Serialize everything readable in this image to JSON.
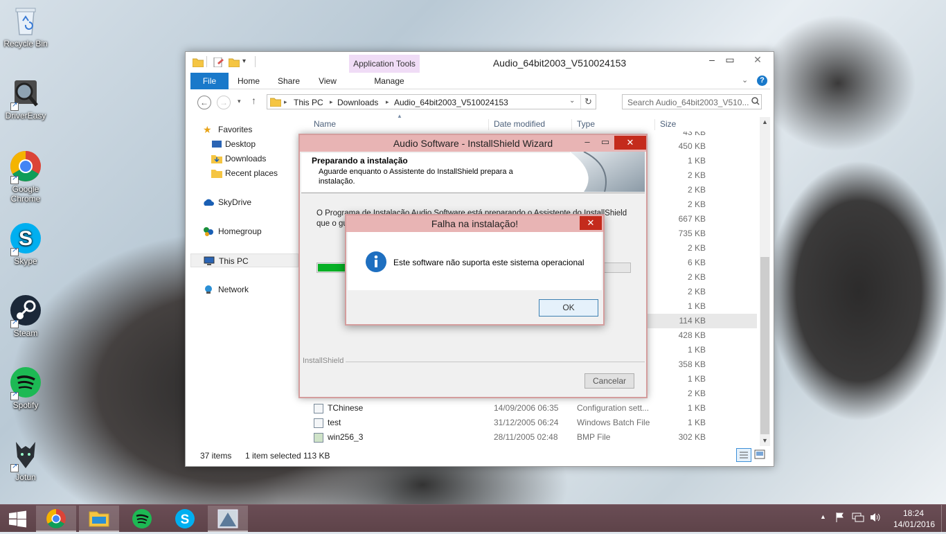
{
  "desktop": {
    "icons": [
      {
        "label": "Recycle Bin",
        "icon": "recycle-bin-icon"
      },
      {
        "label": "DriverEasy",
        "icon": "drivereasy-icon"
      },
      {
        "label": "Google Chrome",
        "icon": "chrome-icon"
      },
      {
        "label": "Skype",
        "icon": "skype-icon"
      },
      {
        "label": "Steam",
        "icon": "steam-icon"
      },
      {
        "label": "Spotify",
        "icon": "spotify-icon"
      },
      {
        "label": "Jotun",
        "icon": "jotun-icon"
      }
    ]
  },
  "explorer": {
    "title": "Audio_64bit2003_V510024153",
    "context_tab": "Application Tools",
    "ribbon_tabs": [
      "File",
      "Home",
      "Share",
      "View",
      "Manage"
    ],
    "breadcrumb": [
      "This PC",
      "Downloads",
      "Audio_64bit2003_V510024153"
    ],
    "search_placeholder": "Search Audio_64bit2003_V510...",
    "nav": {
      "favorites": "Favorites",
      "desktop": "Desktop",
      "downloads": "Downloads",
      "recent": "Recent places",
      "skydrive": "SkyDrive",
      "homegroup": "Homegroup",
      "this_pc": "This PC",
      "network": "Network"
    },
    "columns": {
      "name": "Name",
      "date": "Date modified",
      "type": "Type",
      "size": "Size"
    },
    "partial_sizes": [
      "43 KB",
      "450 KB",
      "1 KB",
      "2 KB",
      "2 KB",
      "2 KB",
      "667 KB",
      "735 KB",
      "2 KB",
      "6 KB",
      "2 KB",
      "2 KB",
      "1 KB",
      "114 KB",
      "428 KB",
      "1 KB",
      "358 KB",
      "1 KB",
      "2 KB"
    ],
    "files": [
      {
        "name": "TChinese",
        "date": "14/09/2006 06:35",
        "type": "Configuration sett...",
        "size": "1 KB"
      },
      {
        "name": "test",
        "date": "31/12/2005 06:24",
        "type": "Windows Batch File",
        "size": "1 KB"
      },
      {
        "name": "win256_3",
        "date": "28/11/2005 02:48",
        "type": "BMP File",
        "size": "302 KB"
      }
    ],
    "status": {
      "items": "37 items",
      "selected": "1 item selected",
      "size": "113 KB"
    }
  },
  "wizard": {
    "title": "Audio Software - InstallShield Wizard",
    "heading": "Preparando a instalação",
    "subheading": "Aguarde enquanto o Assistente do InstallShield prepara a instalação.",
    "body": "O Programa de Instalação Audio Software está preparando o Assistente do InstallShield que o guiará pe",
    "progress": 0.1,
    "brand": "InstallShield",
    "cancel": "Cancelar"
  },
  "error_dialog": {
    "title": "Falha na instalação!",
    "message": "Este software não suporta este sistema operacional",
    "ok": "OK"
  },
  "taskbar": {
    "apps": [
      "start-icon",
      "chrome-icon",
      "file-explorer-icon",
      "spotify-icon",
      "skype-icon",
      "installer-icon"
    ],
    "time": "18:24",
    "date": "14/01/2016"
  }
}
